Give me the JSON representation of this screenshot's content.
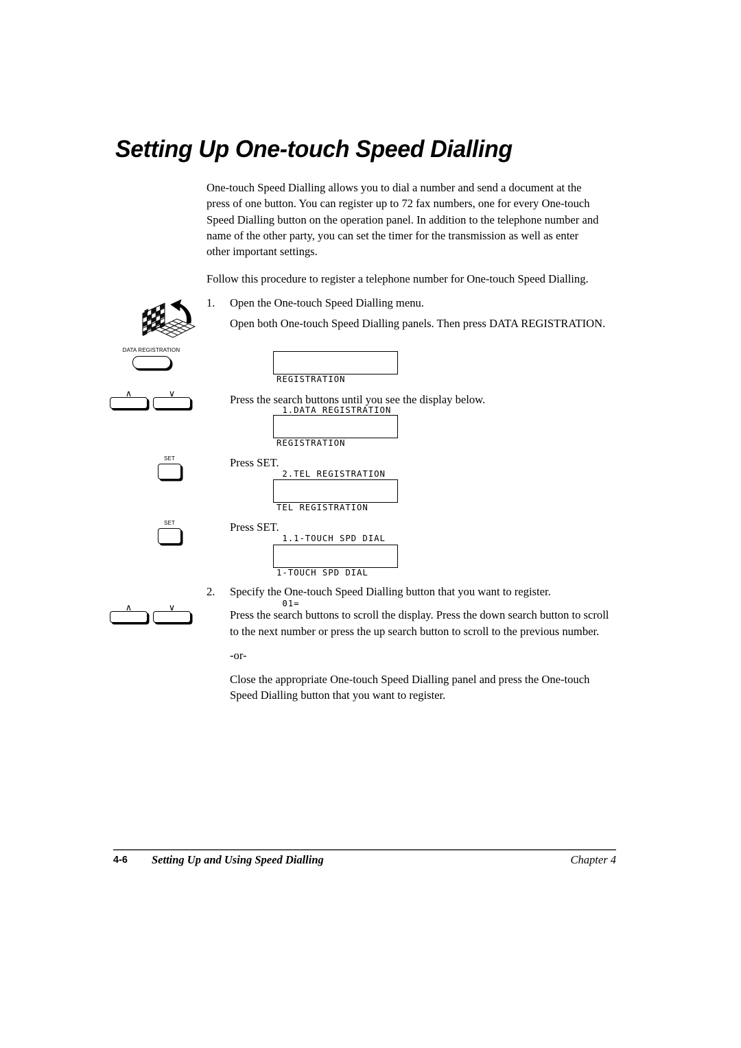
{
  "page": {
    "title": "Setting Up One-touch Speed Dialling"
  },
  "intro": {
    "paragraph_1": "One-touch Speed Dialling allows you to dial a number and send a document at the press of one button. You can register up to 72 fax numbers, one for every One-touch Speed Dialling button on the operation panel. In addition to the telephone number and name of the other party, you can set the timer for the transmission as well as enter other important settings.",
    "paragraph_2": "Follow this procedure to register a telephone number for One-touch Speed Dialling."
  },
  "steps": [
    {
      "number": "1.",
      "text": "Open the One-touch Speed Dialling menu.",
      "detail": "Open both One-touch Speed Dialling panels. Then press DATA REGISTRATION."
    },
    {
      "number": "2.",
      "text": "Specify the One-touch Speed Dialling button that you want to register.",
      "detail": "Press the search buttons to scroll the display. Press the down search button to scroll to the next number or press the up search button to scroll to the previous number.",
      "or_separator": "-or-",
      "alternative": "Close the appropriate One-touch Speed Dialling panel and press the One-touch Speed Dialling button that you want to register."
    }
  ],
  "instructions": {
    "press_search": "Press the search buttons until you see the display below.",
    "press_set_1": "Press SET.",
    "press_set_2": "Press SET."
  },
  "displays": [
    {
      "line1": "REGISTRATION",
      "line2": " 1.DATA REGISTRATION"
    },
    {
      "line1": "REGISTRATION",
      "line2": " 2.TEL REGISTRATION"
    },
    {
      "line1": "TEL REGISTRATION",
      "line2": " 1.1-TOUCH SPD DIAL"
    },
    {
      "line1": "1-TOUCH SPD DIAL",
      "line2": " 01="
    }
  ],
  "controls": {
    "data_registration_label": "DATA REGISTRATION",
    "set_label_1": "SET",
    "set_label_2": "SET",
    "search_up_caret": "∧",
    "search_down_caret": "∨"
  },
  "footer": {
    "page_number": "4-6",
    "title": "Setting Up and Using Speed Dialling",
    "chapter": "Chapter 4"
  }
}
